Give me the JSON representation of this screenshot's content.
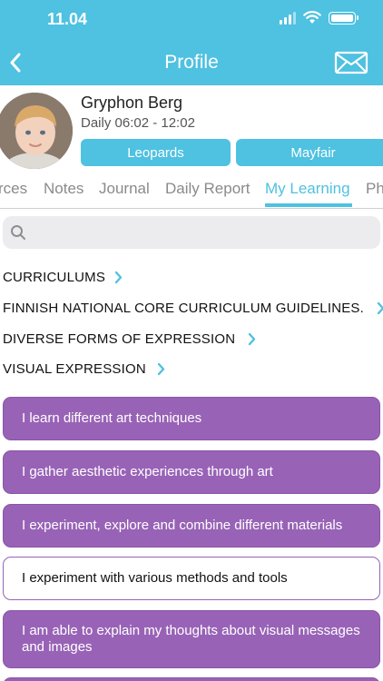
{
  "status_bar": {
    "time": "11.04"
  },
  "nav": {
    "title": "Profile",
    "icons": {
      "back": "chevron-left-icon",
      "mail": "envelope-icon"
    }
  },
  "profile": {
    "name": "Gryphon Berg",
    "schedule": "Daily 06:02 - 12:02",
    "groups": [
      "Leopards",
      "Mayfair"
    ]
  },
  "tabs": [
    "rces",
    "Notes",
    "Journal",
    "Daily Report",
    "My Learning",
    "Ph"
  ],
  "active_tab": "My Learning",
  "search": {
    "placeholder": ""
  },
  "breadcrumbs": [
    "CURRICULUMS",
    "FINNISH NATIONAL CORE CURRICULUM GUIDELINES.",
    "DIVERSE FORMS OF EXPRESSION",
    "VISUAL EXPRESSION"
  ],
  "learning_items": [
    {
      "text": "I learn different art techniques",
      "selected": true
    },
    {
      "text": "I gather aesthetic experiences through art",
      "selected": true
    },
    {
      "text": "I experiment, explore and combine different materials",
      "selected": true
    },
    {
      "text": "I experiment with various methods and tools",
      "selected": false
    },
    {
      "text": "I am able to explain my thoughts about visual messages and images",
      "selected": true
    }
  ],
  "colors": {
    "accent": "#4fc1e1",
    "purple": "#9863b6"
  }
}
